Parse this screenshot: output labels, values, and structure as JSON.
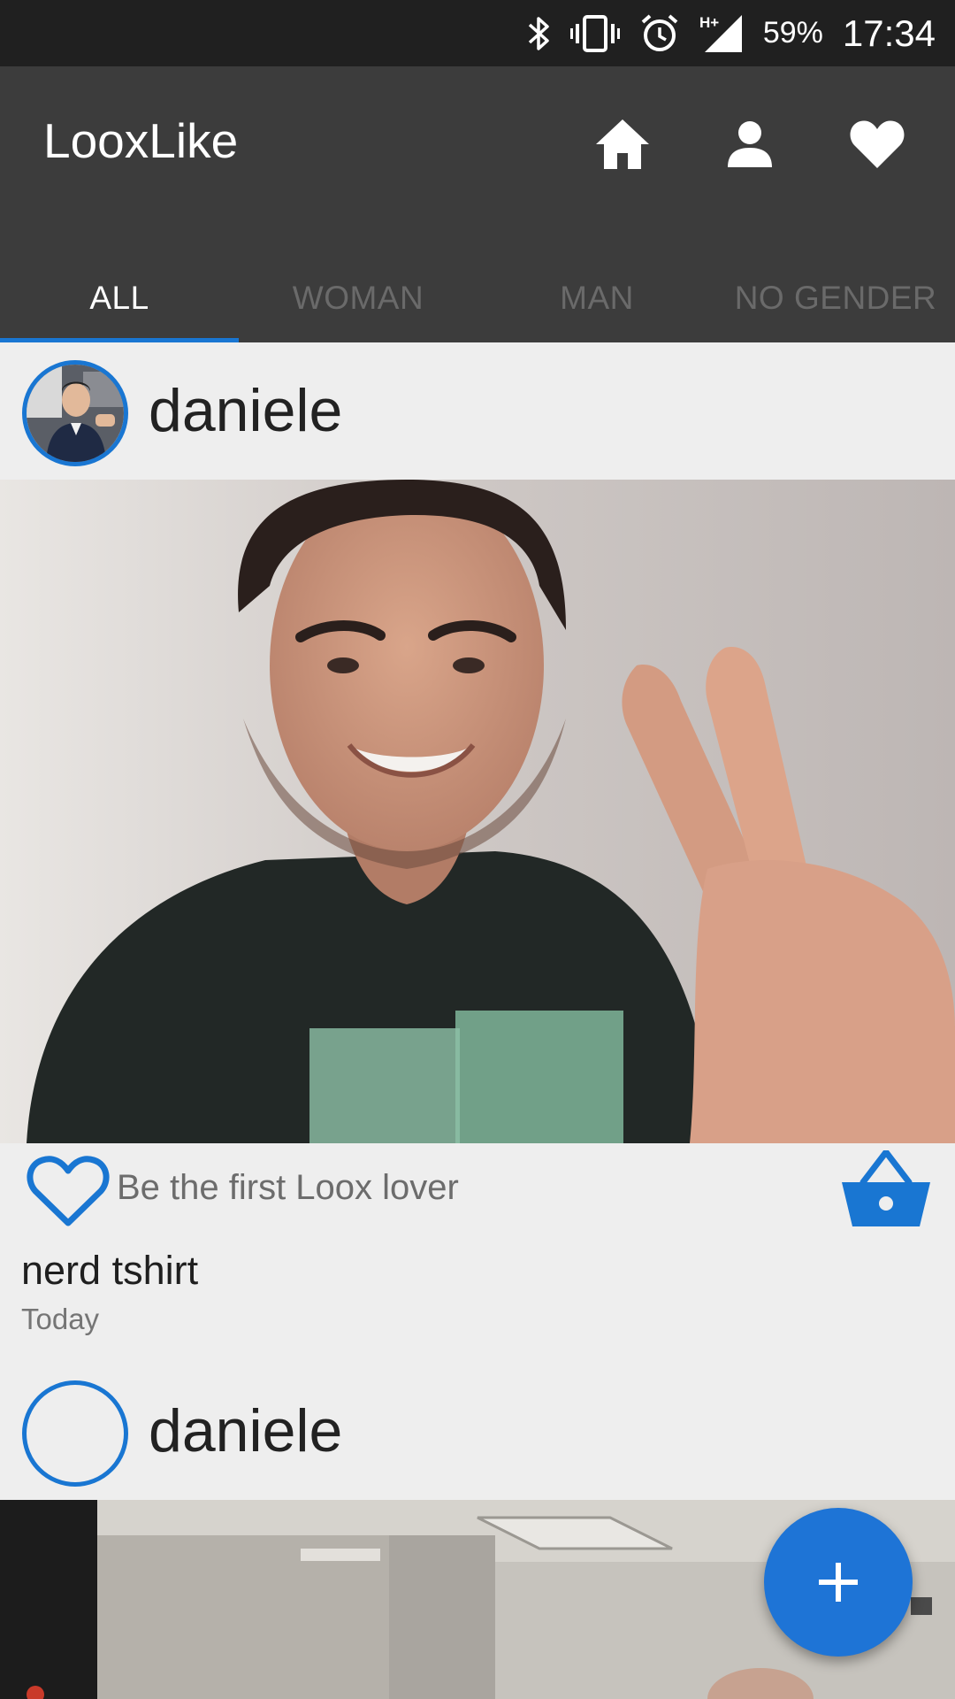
{
  "status_bar": {
    "battery": "59%",
    "time": "17:34",
    "icons": [
      "bluetooth-icon",
      "vibrate-icon",
      "alarm-icon",
      "signal-icon"
    ]
  },
  "app_bar": {
    "title": "LooxLike",
    "actions": [
      "home-icon",
      "profile-icon",
      "favorites-icon"
    ]
  },
  "tabs": [
    {
      "label": "ALL",
      "active": true
    },
    {
      "label": "WOMAN",
      "active": false
    },
    {
      "label": "MAN",
      "active": false
    },
    {
      "label": "NO GENDER",
      "active": false
    }
  ],
  "colors": {
    "accent": "#1976d2",
    "app_bar": "#3c3c3c",
    "status_bar": "#202020",
    "background": "#eeeeee"
  },
  "posts": [
    {
      "username": "daniele",
      "like_text": "Be the first Loox lover",
      "title": "nerd tshirt",
      "date": "Today"
    },
    {
      "username": "daniele"
    }
  ],
  "fab": {
    "icon": "plus-icon"
  }
}
